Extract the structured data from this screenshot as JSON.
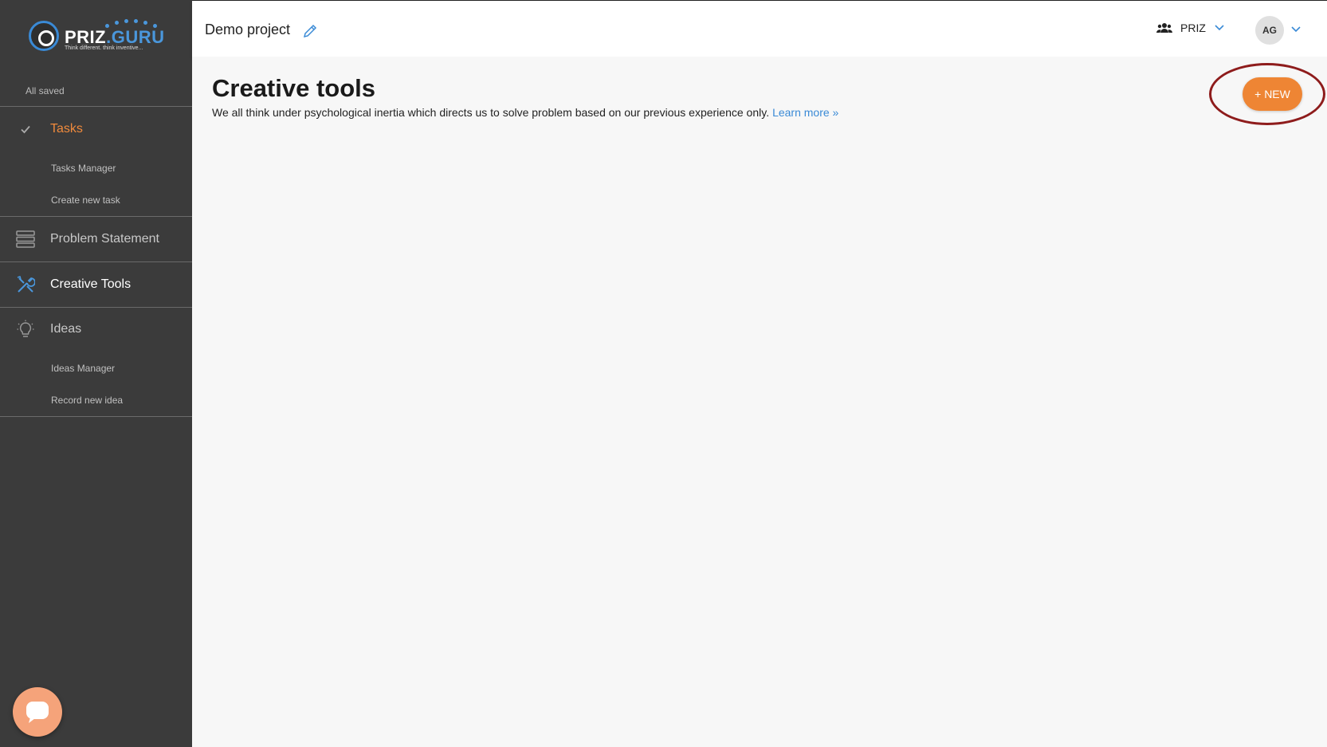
{
  "logo": {
    "brand_priz": "PRIZ",
    "brand_guru": ".GURU",
    "tagline": "Think different. think inventive..."
  },
  "sidebar": {
    "status": "All saved",
    "tasks": {
      "label": "Tasks",
      "items": [
        "Tasks Manager",
        "Create new task"
      ]
    },
    "problem_statement": {
      "label": "Problem Statement"
    },
    "creative_tools": {
      "label": "Creative Tools"
    },
    "ideas": {
      "label": "Ideas",
      "items": [
        "Ideas Manager",
        "Record new idea"
      ]
    }
  },
  "header": {
    "project_title": "Demo project",
    "team_label": "PRIZ",
    "avatar_initials": "AG"
  },
  "main": {
    "title": "Creative tools",
    "description": "We all think under psychological inertia which directs us to solve problem based on our previous experience only.",
    "learn_more": "Learn more »",
    "new_button": "+ NEW"
  },
  "colors": {
    "accent_orange": "#ee8534",
    "sidebar_bg": "#3b3b3b",
    "link_blue": "#3a8ad6",
    "highlight_ring": "#8e1c1c"
  }
}
